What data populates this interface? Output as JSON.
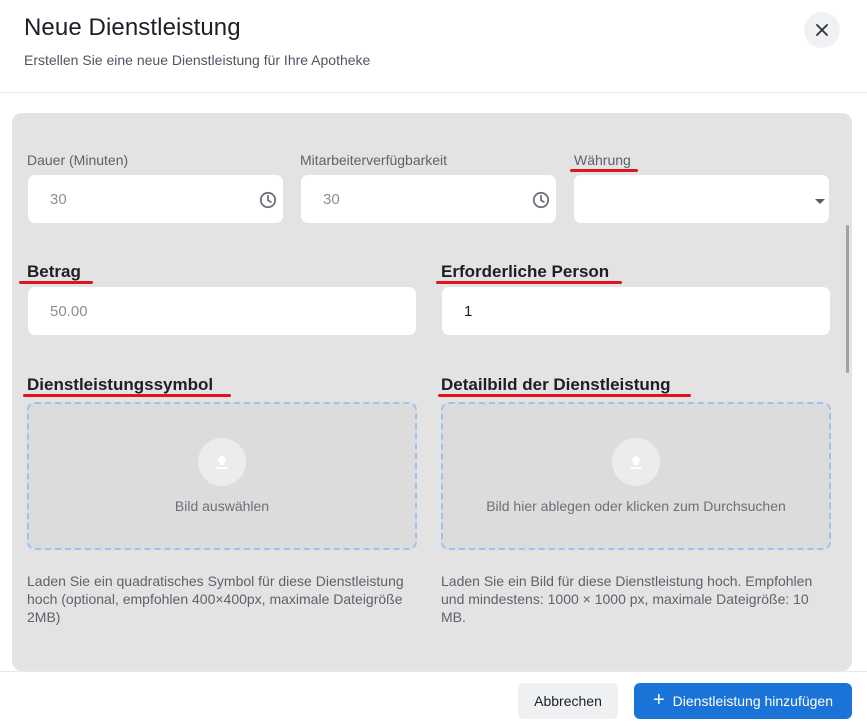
{
  "header": {
    "title": "Neue Dienstleistung",
    "subtitle": "Erstellen Sie eine neue Dienstleistung für Ihre Apotheke"
  },
  "form": {
    "duration": {
      "label": "Dauer (Minuten)",
      "value": "30"
    },
    "staff_availability": {
      "label": "Mitarbeiterverfügbarkeit",
      "value": "30"
    },
    "currency": {
      "label": "Währung",
      "value": ""
    },
    "amount": {
      "label": "Betrag",
      "placeholder": "50.00"
    },
    "required_person": {
      "label": "Erforderliche Person",
      "value": "1"
    },
    "service_icon": {
      "label": "Dienstleistungssymbol",
      "dropzone_text": "Bild auswählen",
      "help": "Laden Sie ein quadratisches Symbol für diese Dienstleistung hoch (optional, empfohlen 400×400px, maximale Dateigröße 2MB)"
    },
    "detail_image": {
      "label": "Detailbild der Dienstleistung",
      "dropzone_text": "Bild hier ablegen oder klicken zum Durchsuchen",
      "help": "Laden Sie ein Bild für diese Dienstleistung hoch. Empfohlen und mindestens: 1000 × 1000 px, maximale Dateigröße: 10 MB."
    }
  },
  "footer": {
    "cancel_label": "Abbrechen",
    "add_label": "Dienstleistung hinzufügen",
    "add_icon": "plus-icon"
  },
  "icons": {
    "close": "close-icon",
    "clock": "clock-icon",
    "upload": "upload-icon",
    "dropdown": "chevron-down-icon"
  },
  "colors": {
    "accent": "#1a73d6",
    "annotation_underline": "#e0141e",
    "dropzone_border": "#9bc3ee",
    "panel_background": "#e3e3e3"
  }
}
